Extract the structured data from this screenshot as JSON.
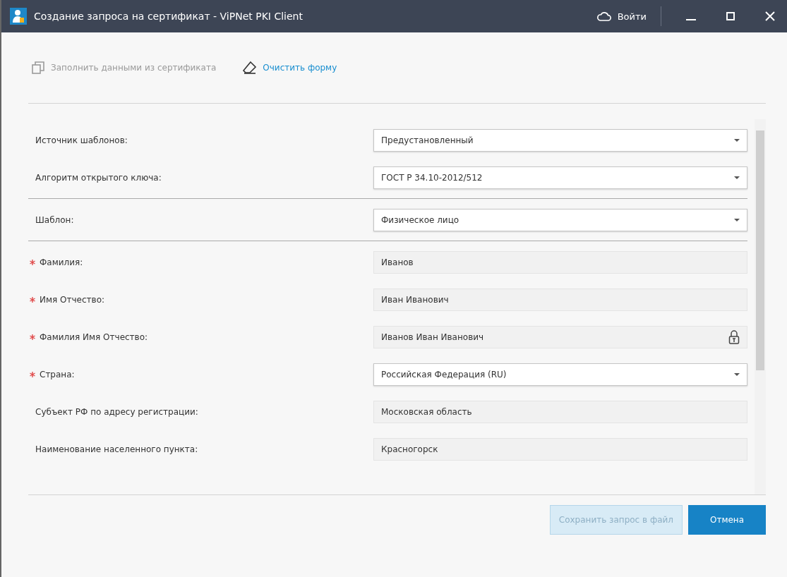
{
  "window": {
    "title": "Создание запроса на сертификат - ViPNet PKI Client",
    "login": "Войти"
  },
  "toolbar": [
    {
      "label": "Заполнить данными из сертификата",
      "kind": "copy",
      "disabled": true
    },
    {
      "label": "Очистить форму",
      "kind": "eraser",
      "disabled": false
    }
  ],
  "sections": [
    {
      "rows": [
        {
          "label": "Источник шаблонов:",
          "kind": "select",
          "value": "Предустановленный",
          "required": false
        },
        {
          "label": "Алгоритм открытого ключа:",
          "kind": "select",
          "value": "ГОСТ Р 34.10-2012/512",
          "required": false
        }
      ]
    },
    {
      "rows": [
        {
          "label": "Шаблон:",
          "kind": "select",
          "value": "Физическое лицо",
          "required": false
        }
      ]
    },
    {
      "rows": [
        {
          "label": "Фамилия:",
          "kind": "text",
          "value": "Иванов",
          "required": true,
          "locked": false
        },
        {
          "label": "Имя Отчество:",
          "kind": "text",
          "value": "Иван Иванович",
          "required": true,
          "locked": false
        },
        {
          "label": "Фамилия Имя Отчество:",
          "kind": "text",
          "value": "Иванов Иван Иванович",
          "required": true,
          "locked": true
        },
        {
          "label": "Страна:",
          "kind": "select",
          "value": "Российская Федерация (RU)",
          "required": true
        },
        {
          "label": "Субъект РФ по адресу регистрации:",
          "kind": "text",
          "value": "Московская область",
          "required": false,
          "locked": false
        },
        {
          "label": "Наименование населенного пункта:",
          "kind": "text",
          "value": "Красногорск",
          "required": false,
          "locked": false
        }
      ]
    }
  ],
  "buttons": [
    {
      "label": "Сохранить запрос в файл",
      "kind": "secondary",
      "disabled": true
    },
    {
      "label": "Отмена",
      "kind": "primary",
      "disabled": false
    }
  ]
}
